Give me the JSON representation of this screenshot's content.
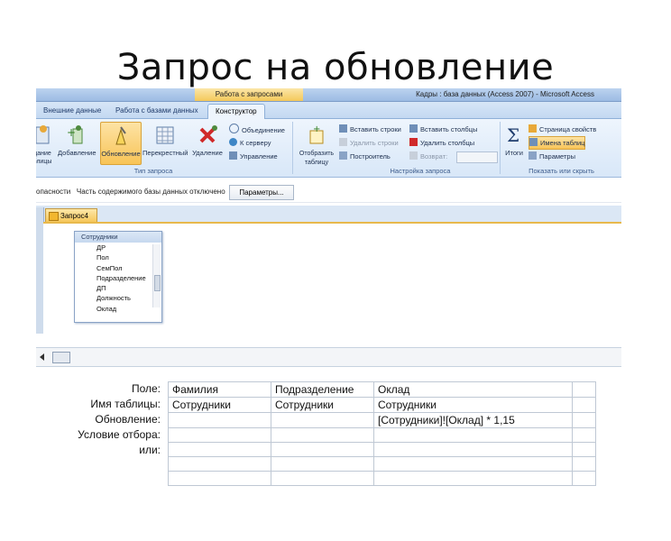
{
  "slide_title": "Запрос на обновление",
  "window": {
    "context_tab": "Работа с запросами",
    "app_title": "Кадры : база данных (Access 2007) - Microsoft Access"
  },
  "tabs": [
    "Внешние данные",
    "Работа с базами данных",
    "Конструктор"
  ],
  "ribbon": {
    "query_type": {
      "label": "Тип запроса",
      "buttons": {
        "create": "дание\nблицы",
        "append": "Добавление",
        "update": "Обновление",
        "crosstab": "Перекрестный",
        "delete": "Удаление"
      },
      "small": [
        "Объединение",
        "К серверу",
        "Управление"
      ]
    },
    "query_setup": {
      "label": "Настройка запроса",
      "show_table": "Отобразить таблицу",
      "insert_rows": "Вставить строки",
      "delete_rows": "Удалить строки",
      "builder": "Построитель",
      "insert_cols": "Вставить столбцы",
      "delete_cols": "Удалить столбцы",
      "return": "Возврат:"
    },
    "show_hide": {
      "label": "Показать или скрыть",
      "totals": "Итоги",
      "property_sheet": "Страница свойств",
      "table_names": "Имена таблиц",
      "parameters": "Параметры"
    }
  },
  "message_bar": {
    "text": "опасности   Часть содержимого базы данных отключено",
    "button": "Параметры..."
  },
  "doc_tab": "Запрос4",
  "table_box": {
    "title": "Сотрудники",
    "fields": [
      "ДР",
      "Пол",
      "СемПол",
      "Подразделение",
      "ДП",
      "Должность",
      "Оклад"
    ]
  },
  "qbe": {
    "row_labels": [
      "Поле:",
      "Имя таблицы:",
      "Обновление:",
      "Условие отбора:",
      "или:"
    ],
    "columns": [
      {
        "field": "Фамилия",
        "table": "Сотрудники",
        "update": "",
        "criteria": "",
        "or": ""
      },
      {
        "field": "Подразделение",
        "table": "Сотрудники",
        "update": "",
        "criteria": "",
        "or": ""
      },
      {
        "field": "Оклад",
        "table": "Сотрудники",
        "update": "[Сотрудники]![Оклад] * 1,15",
        "criteria": "",
        "or": ""
      }
    ]
  }
}
